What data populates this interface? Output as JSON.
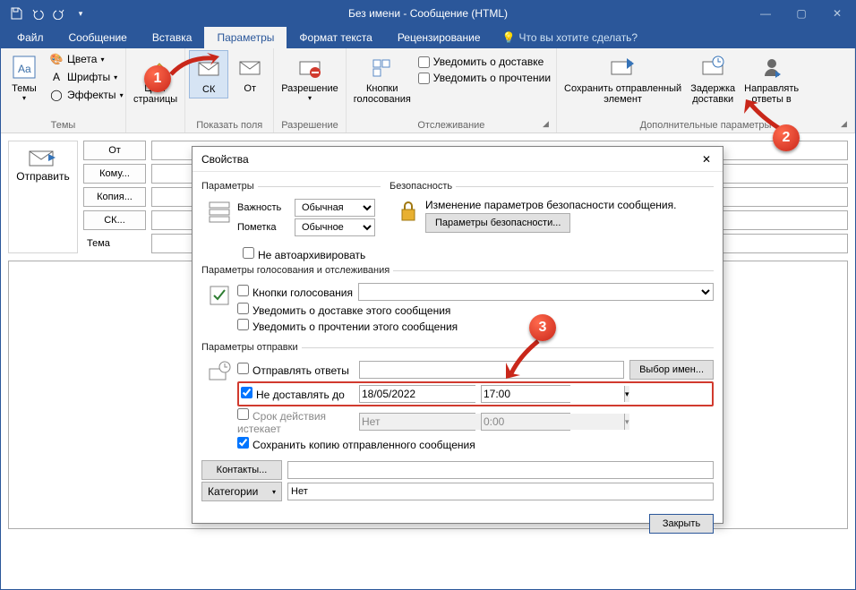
{
  "window": {
    "title": "Без имени - Сообщение (HTML)"
  },
  "menubar": {
    "file": "Файл",
    "message": "Сообщение",
    "insert": "Вставка",
    "options": "Параметры",
    "format": "Формат текста",
    "review": "Рецензирование",
    "tellme": "Что вы хотите сделать?"
  },
  "ribbon": {
    "themes_group": "Темы",
    "themes": "Темы",
    "colors": "Цвета",
    "fonts": "Шрифты",
    "effects": "Эффекты",
    "page_color": "Цвет\nстраницы",
    "show_fields_group": "Показать поля",
    "bcc": "СК",
    "from": "От",
    "permission_group": "Разрешение",
    "permission": "Разрешение",
    "tracking_group": "Отслеживание",
    "voting": "Кнопки\nголосования",
    "delivery_receipt": "Уведомить о доставке",
    "read_receipt": "Уведомить о прочтении",
    "more_group": "Дополнительные параметры",
    "save_sent": "Сохранить отправленный\nэлемент",
    "delay": "Задержка\nдоставки",
    "direct_replies": "Направлять\nответы в"
  },
  "compose": {
    "send": "Отправить",
    "from": "От",
    "to": "Кому...",
    "cc": "Копия...",
    "bcc": "СК...",
    "subject": "Тема"
  },
  "dialog": {
    "title": "Свойства",
    "settings_legend": "Параметры",
    "importance": "Важность",
    "importance_val": "Обычная",
    "sensitivity": "Пометка",
    "sensitivity_val": "Обычное",
    "no_autoarchive": "Не автоархивировать",
    "security_legend": "Безопасность",
    "security_text": "Изменение параметров безопасности сообщения.",
    "security_btn": "Параметры безопасности...",
    "voting_legend": "Параметры голосования и отслеживания",
    "voting_buttons": "Кнопки голосования",
    "delivery_receipt": "Уведомить о доставке этого сообщения",
    "read_receipt": "Уведомить о прочтении этого сообщения",
    "delivery_legend": "Параметры отправки",
    "have_replies": "Отправлять ответы",
    "select_names": "Выбор имен...",
    "do_not_deliver": "Не доставлять до",
    "deliver_date": "18/05/2022",
    "deliver_time": "17:00",
    "expires": "Срок действия истекает",
    "expires_date": "Нет",
    "expires_time": "0:00",
    "save_copy": "Сохранить копию отправленного сообщения",
    "contacts": "Контакты...",
    "categories": "Категории",
    "categories_val": "Нет",
    "close": "Закрыть"
  },
  "markers": {
    "m1": "1",
    "m2": "2",
    "m3": "3"
  }
}
